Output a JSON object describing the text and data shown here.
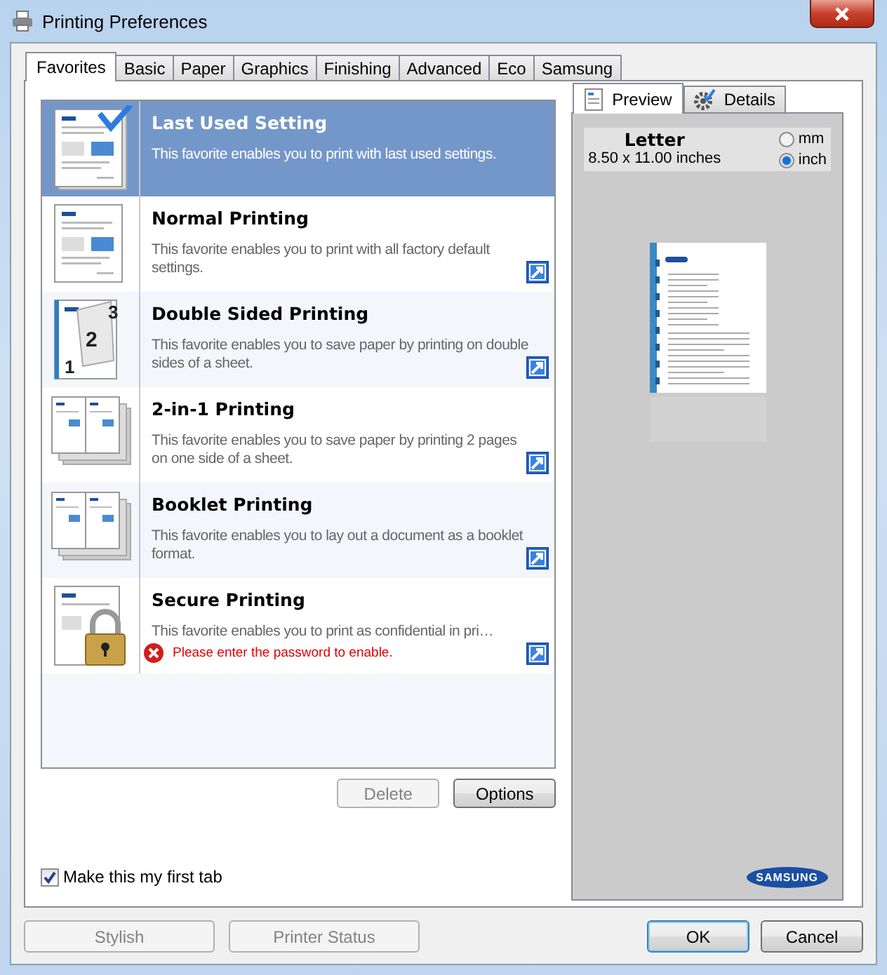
{
  "window": {
    "title": "Printing Preferences"
  },
  "tabs": [
    {
      "label": "Favorites",
      "selected": true
    },
    {
      "label": "Basic",
      "selected": false
    },
    {
      "label": "Paper",
      "selected": false
    },
    {
      "label": "Graphics",
      "selected": false
    },
    {
      "label": "Finishing",
      "selected": false
    },
    {
      "label": "Advanced",
      "selected": false
    },
    {
      "label": "Eco",
      "selected": false
    },
    {
      "label": "Samsung",
      "selected": false
    }
  ],
  "favorites": [
    {
      "kind": "page-check",
      "title": "Last Used Setting",
      "description": "This favorite enables you to print with last used settings.",
      "selected": true,
      "shortcut": false
    },
    {
      "kind": "page",
      "title": "Normal Printing",
      "description": "This favorite enables you to print with all factory default settings.",
      "selected": false,
      "shortcut": true
    },
    {
      "kind": "duplex",
      "page_numbers": [
        "3",
        "2",
        "1"
      ],
      "title": "Double Sided Printing",
      "description": "This favorite enables you to save paper by printing on double sides of a sheet.",
      "selected": false,
      "shortcut": true
    },
    {
      "kind": "two-up",
      "title": "2-in-1 Printing",
      "description": "This favorite enables you to save paper by printing 2 pages on one side of a sheet.",
      "selected": false,
      "shortcut": true
    },
    {
      "kind": "two-up",
      "title": "Booklet Printing",
      "description": "This favorite enables you to lay out a document as a booklet format.",
      "selected": false,
      "shortcut": true
    },
    {
      "kind": "lock",
      "title": "Secure Printing",
      "description": "This favorite enables you to print as confidential in pri…",
      "error": "Please enter the password to enable.",
      "selected": false,
      "shortcut": true
    }
  ],
  "list_buttons": [
    {
      "label": "Delete",
      "disabled": true
    },
    {
      "label": "Options",
      "disabled": false
    }
  ],
  "first_tab": {
    "label": "Make this my first tab",
    "checked": true
  },
  "preview": {
    "tabs": [
      {
        "label": "Preview",
        "kind": "page",
        "selected": true
      },
      {
        "label": "Details",
        "kind": "gear",
        "selected": false
      }
    ],
    "paper": "Letter",
    "size": "8.50 x 11.00 inches",
    "units": [
      {
        "label": "mm",
        "selected": false
      },
      {
        "label": "inch",
        "selected": true
      }
    ],
    "logo": "SAMSUNG"
  },
  "footer_buttons": [
    {
      "label": "Stylish",
      "disabled": true,
      "default": false
    },
    {
      "label": "Printer Status",
      "disabled": true,
      "default": false
    },
    {
      "label": "OK",
      "disabled": false,
      "default": true
    },
    {
      "label": "Cancel",
      "disabled": false,
      "default": false
    }
  ]
}
